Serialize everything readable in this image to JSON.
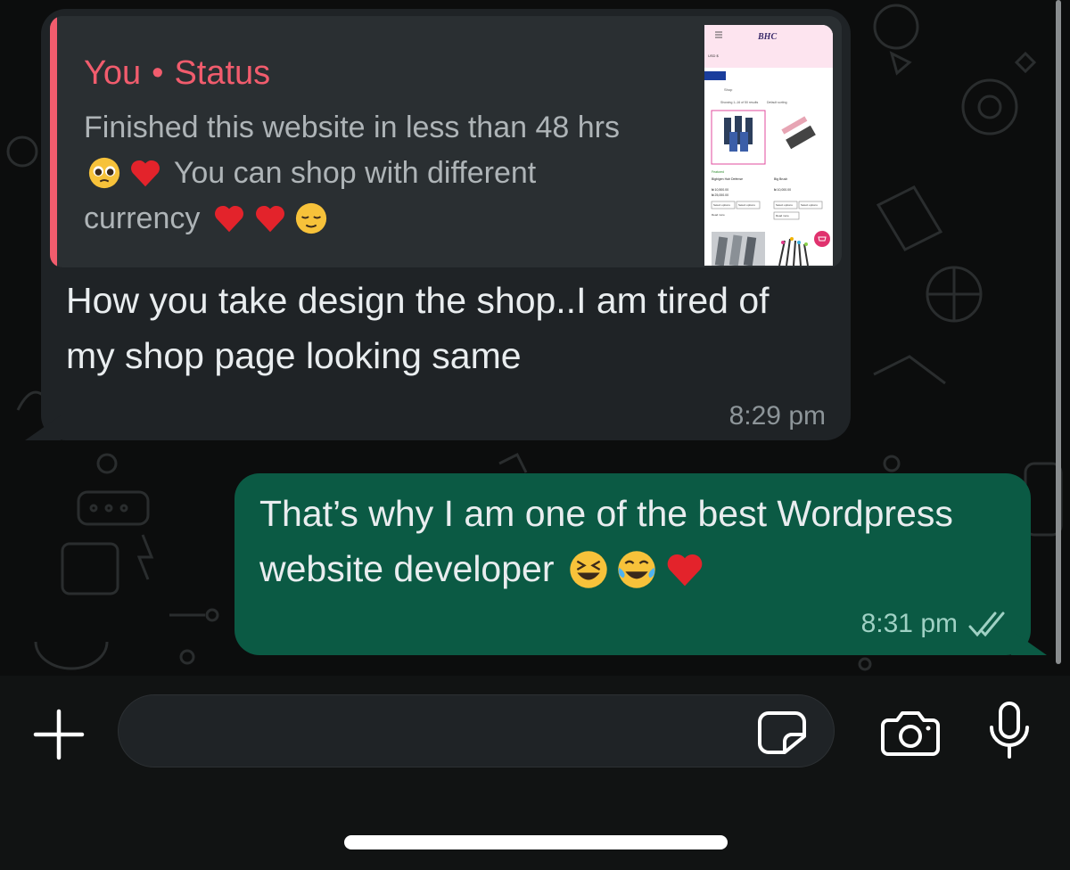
{
  "incoming": {
    "quote_sender": "You",
    "quote_separator": "•",
    "quote_type": "Status",
    "quote_text_1": "Finished this website in less than 48 hrs",
    "quote_text_2": "You can shop with different",
    "quote_text_3": "currency",
    "thumb": {
      "brand": "BHC",
      "usd_badge": "USD $",
      "shop_label": "Shop",
      "showing_text": "Showing 1–16 of 50 results",
      "sort_label": "Default sorting",
      "product1_tag": "Featured",
      "product1_name": "Bigbigen Hair Defense",
      "product1_price1": "₦ 10,500.00",
      "product1_price2": "₦ 25,000.00",
      "product2_name": "Big Brush",
      "product2_price": "₦ 10,000.00",
      "select_options": "Select options",
      "read_more": "Read more"
    },
    "message": "How you take design the shop..I am tired of my shop page looking same",
    "time": "8:29 pm"
  },
  "outgoing": {
    "message": "That’s why I am one of the best Wordpress website developer",
    "time": "8:31 pm",
    "status": "read"
  },
  "composer": {
    "placeholder": ""
  },
  "icons": [
    "plus-icon",
    "sticker-icon",
    "camera-icon",
    "microphone-icon",
    "double-check-icon"
  ],
  "colors": {
    "incoming_bubble": "#1f2326",
    "outgoing_bubble": "#0b5a44",
    "quote_accent": "#f15c6d",
    "read_ticks": "#9fd1c4"
  }
}
